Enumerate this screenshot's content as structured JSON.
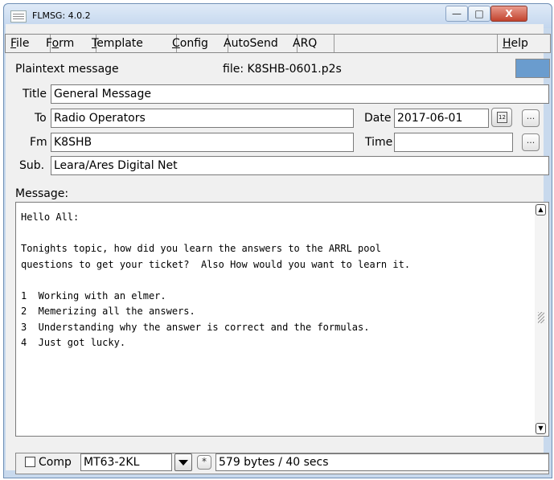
{
  "window": {
    "title": "FLMSG: 4.0.2",
    "minimize_glyph": "—",
    "maximize_glyph": "□",
    "close_glyph": "X"
  },
  "menu": {
    "file": {
      "u": "F",
      "rest": "ile"
    },
    "form": {
      "pre": "F",
      "u": "o",
      "rest": "rm"
    },
    "template": {
      "u": "T",
      "rest": "emplate"
    },
    "config": {
      "u": "C",
      "rest": "onfig"
    },
    "autosend": "AutoSend",
    "arq": "ARQ",
    "help": {
      "u": "H",
      "rest": "elp"
    }
  },
  "status": {
    "form_type": "Plaintext message",
    "file_label": "file: K8SHB-0601.p2s",
    "indicator_color": "#6a9cce"
  },
  "fields": {
    "title_label": "Title",
    "title_value": "General Message",
    "to_label": "To",
    "to_value": "Radio Operators",
    "date_label": "Date",
    "date_value": "2017-06-01",
    "calendar_day": "12",
    "date_more": "...",
    "fm_label": "Fm",
    "fm_value": "K8SHB",
    "time_label": "Time",
    "time_value": "",
    "time_more": "...",
    "sub_label": "Sub.",
    "sub_value": "Leara/Ares Digital Net"
  },
  "message": {
    "label": "Message:",
    "text": "Hello All:\n\nTonights topic, how did you learn the answers to the ARRL pool\nquestions to get your ticket?  Also How would you want to learn it.\n\n1  Working with an elmer.\n2  Memerizing all the answers.\n3  Understanding why the answer is correct and the formulas.\n4  Just got lucky."
  },
  "bottom": {
    "comp_label": "Comp",
    "comp_checked": false,
    "mode": "MT63-2KL",
    "star": "*",
    "transfer_info": "579 bytes / 40 secs"
  }
}
